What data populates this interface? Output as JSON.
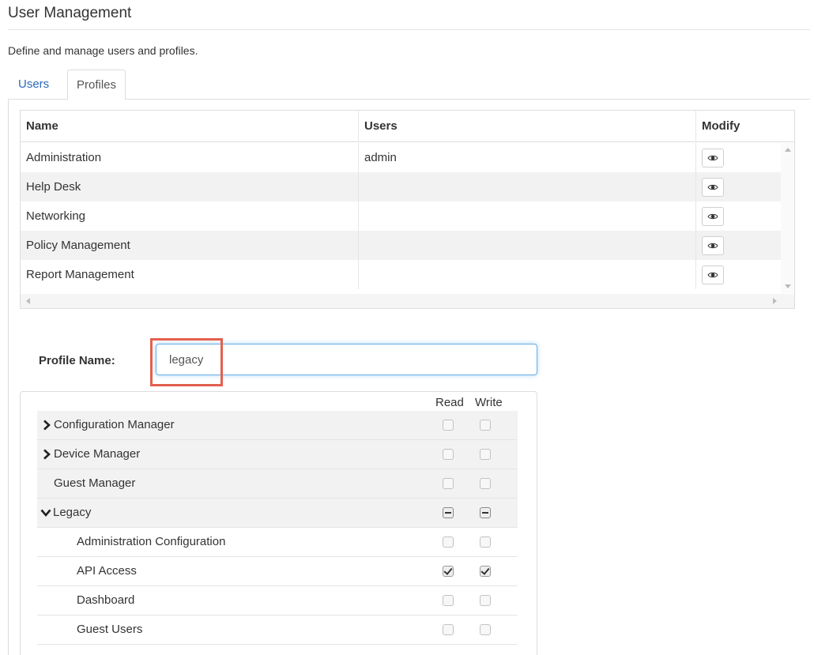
{
  "header": {
    "title": "User Management",
    "description": "Define and manage users and profiles."
  },
  "tabs": [
    {
      "label": "Users",
      "active": false
    },
    {
      "label": "Profiles",
      "active": true
    }
  ],
  "profiles_table": {
    "columns": {
      "name": "Name",
      "users": "Users",
      "modify": "Modify"
    },
    "rows": [
      {
        "name": "Administration",
        "users": "admin"
      },
      {
        "name": "Help Desk",
        "users": ""
      },
      {
        "name": "Networking",
        "users": ""
      },
      {
        "name": "Policy Management",
        "users": ""
      },
      {
        "name": "Report Management",
        "users": ""
      }
    ],
    "modify_icon": "eye-icon"
  },
  "profile_form": {
    "label": "Profile Name:",
    "value": "legacy"
  },
  "permissions": {
    "read_label": "Read",
    "write_label": "Write",
    "items": [
      {
        "label": "Configuration Manager",
        "read": "unchecked",
        "write": "unchecked",
        "expander": "collapsed"
      },
      {
        "label": "Device Manager",
        "read": "unchecked",
        "write": "unchecked",
        "expander": "collapsed"
      },
      {
        "label": "Guest Manager",
        "read": "unchecked",
        "write": "unchecked",
        "expander": "none"
      },
      {
        "label": "Legacy",
        "read": "indeterminate",
        "write": "indeterminate",
        "expander": "expanded"
      },
      {
        "label": "Administration Configuration",
        "read": "unchecked",
        "write": "unchecked",
        "expander": "child"
      },
      {
        "label": "API Access",
        "read": "checked",
        "write": "checked",
        "expander": "child"
      },
      {
        "label": "Dashboard",
        "read": "unchecked",
        "write": "unchecked",
        "expander": "child"
      },
      {
        "label": "Guest Users",
        "read": "unchecked",
        "write": "unchecked",
        "expander": "child"
      }
    ]
  },
  "colors": {
    "link": "#2a6ab8",
    "highlight": "#e3604f",
    "focus": "#66afe9"
  }
}
